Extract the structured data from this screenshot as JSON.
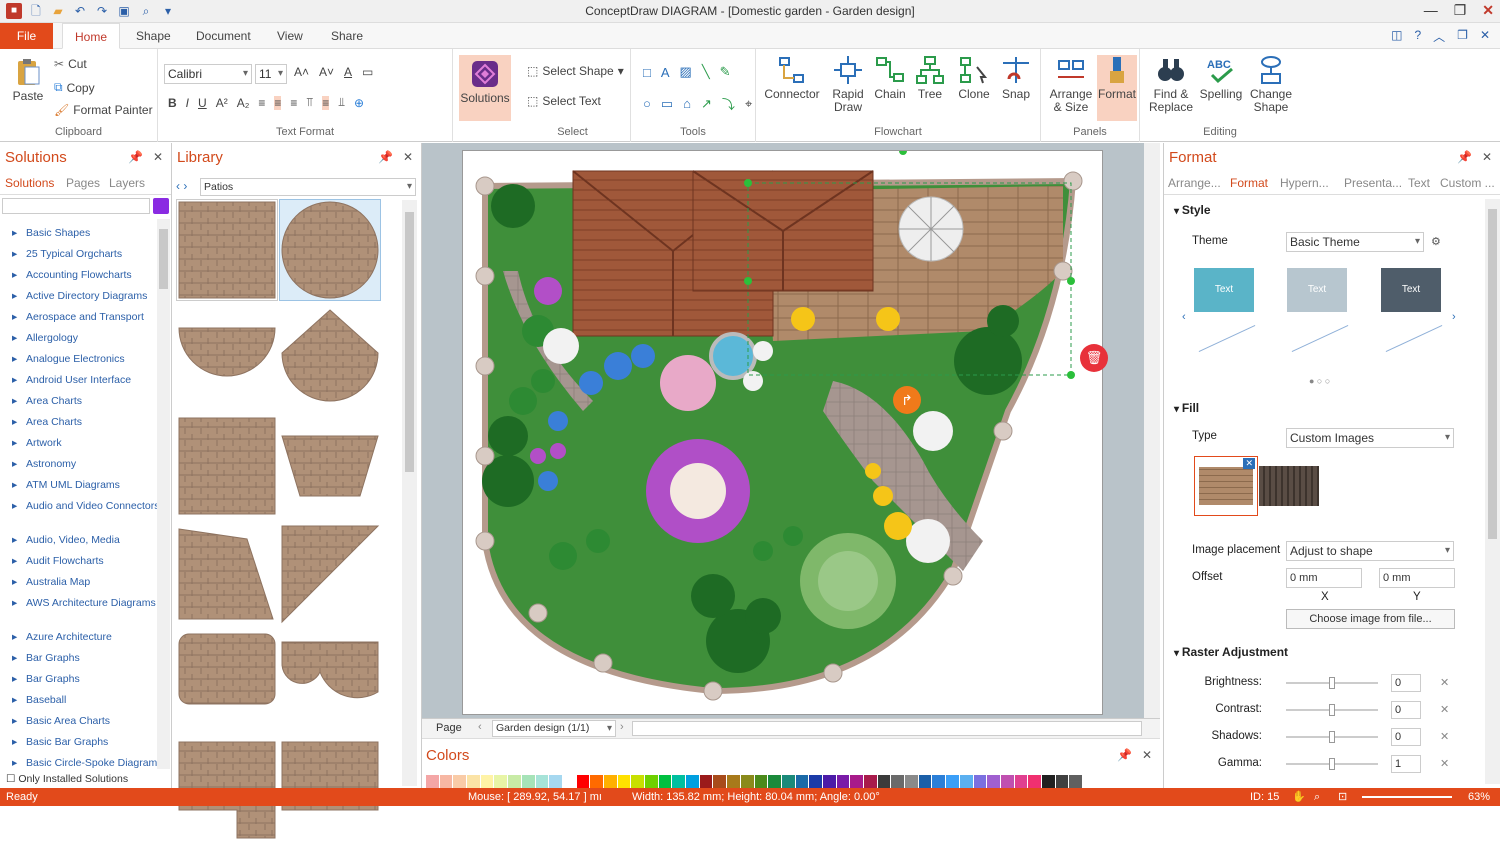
{
  "window": {
    "title": "ConceptDraw DIAGRAM - [Domestic garden - Garden design]"
  },
  "tabs": {
    "file": "File",
    "home": "Home",
    "shape": "Shape",
    "document": "Document",
    "view": "View",
    "share": "Share"
  },
  "clipboard": {
    "paste": "Paste",
    "cut": "Cut",
    "copy": "Copy",
    "format_painter": "Format Painter",
    "label": "Clipboard"
  },
  "text_format": {
    "font": "Calibri",
    "size": "11",
    "label": "Text Format"
  },
  "solutions_btn": "Solutions",
  "select": {
    "select_shape": "Select Shape",
    "select_text": "Select Text",
    "label": "Select"
  },
  "tools": {
    "label": "Tools"
  },
  "connector": {
    "connector": "Connector",
    "rapid_draw": "Rapid Draw",
    "chain": "Chain",
    "tree": "Tree",
    "clone": "Clone",
    "snap": "Snap",
    "label": "Flowchart"
  },
  "panels": {
    "arrange": "Arrange & Size",
    "format": "Format",
    "label": "Panels"
  },
  "editing": {
    "find": "Find & Replace",
    "spelling": "Spelling",
    "change_shape": "Change Shape",
    "label": "Editing"
  },
  "solutions_panel": {
    "title": "Solutions",
    "tabs": [
      "Solutions",
      "Pages",
      "Layers"
    ],
    "items": [
      "Basic Shapes",
      "25 Typical Orgcharts",
      "Accounting Flowcharts",
      "Active Directory Diagrams",
      "Aerospace and Transport",
      "Allergology",
      "Analogue Electronics",
      "Android User Interface",
      "Area Charts",
      "Area Charts",
      "Artwork",
      "Astronomy",
      "ATM UML Diagrams",
      "Audio and Video Connectors",
      "Audio, Video, Media",
      "Audit Flowcharts",
      "Australia Map",
      "AWS Architecture Diagrams",
      "Azure Architecture",
      "Bar Graphs",
      "Bar Graphs",
      "Baseball",
      "Basic Area Charts",
      "Basic Bar Graphs",
      "Basic Circle-Spoke Diagrams"
    ],
    "only_installed": "Only Installed Solutions"
  },
  "library": {
    "title": "Library",
    "selected": "Patios"
  },
  "pagebar": {
    "page_label": "Page",
    "page_name": "Garden design (1/1)"
  },
  "colors": {
    "title": "Colors",
    "swatches": [
      "#f4a6a6",
      "#f7b7a3",
      "#f9cba7",
      "#fbe3a6",
      "#fff3a6",
      "#e8f5a6",
      "#c8eba6",
      "#a6e3b8",
      "#a6e3d8",
      "#a6d8f0",
      "#ffffff",
      "#ff0000",
      "#ff6a00",
      "#ffb000",
      "#ffe100",
      "#c8e000",
      "#6fd000",
      "#00c040",
      "#00c0a0",
      "#00a0e0",
      "#9b1b1b",
      "#a84b1b",
      "#a87a1b",
      "#8a8a1b",
      "#4b8a1b",
      "#1b8a3b",
      "#1b8a7a",
      "#1b6aa8",
      "#1b3ba8",
      "#4b1ba8",
      "#7a1ba8",
      "#a81b8a",
      "#a81b4b",
      "#3b3b3b",
      "#6a6a6a",
      "#8a8a8a",
      "#1b5fa8",
      "#2b7fd8",
      "#3b9ff8",
      "#5bb0f0",
      "#7b70e0",
      "#a060d0",
      "#c050b0",
      "#e04090",
      "#f03070",
      "#202020",
      "#404040",
      "#606060"
    ]
  },
  "format_panel": {
    "title": "Format",
    "tabs": [
      "Arrange...",
      "Format",
      "Hypern...",
      "Presenta...",
      "Text",
      "Custom ..."
    ],
    "style_section": "Style",
    "theme_label": "Theme",
    "theme_value": "Basic Theme",
    "theme_previews": [
      {
        "text": "Text",
        "color": "#5ab4c8"
      },
      {
        "text": "Text",
        "color": "#b7c6cf"
      },
      {
        "text": "Text",
        "color": "#4f5d6a"
      }
    ],
    "fill_section": "Fill",
    "type_label": "Type",
    "type_value": "Custom Images",
    "image_placement_label": "Image placement",
    "image_placement_value": "Adjust to shape",
    "offset_label": "Offset",
    "offset_x": "0 mm",
    "offset_y": "0 mm",
    "x_label": "X",
    "y_label": "Y",
    "choose_image": "Choose image from file...",
    "raster_section": "Raster Adjustment",
    "brightness_label": "Brightness:",
    "brightness": "0",
    "contrast_label": "Contrast:",
    "contrast": "0",
    "shadows_label": "Shadows:",
    "shadows": "0",
    "gamma_label": "Gamma:",
    "gamma": "1"
  },
  "status": {
    "ready": "Ready",
    "mouse": "Mouse: [ 289.92, 54.17 ] mı",
    "size": "Width: 135.82 mm;  Height: 80.04 mm;  Angle: 0.00°",
    "id": "ID: 15",
    "zoom": "63%"
  }
}
